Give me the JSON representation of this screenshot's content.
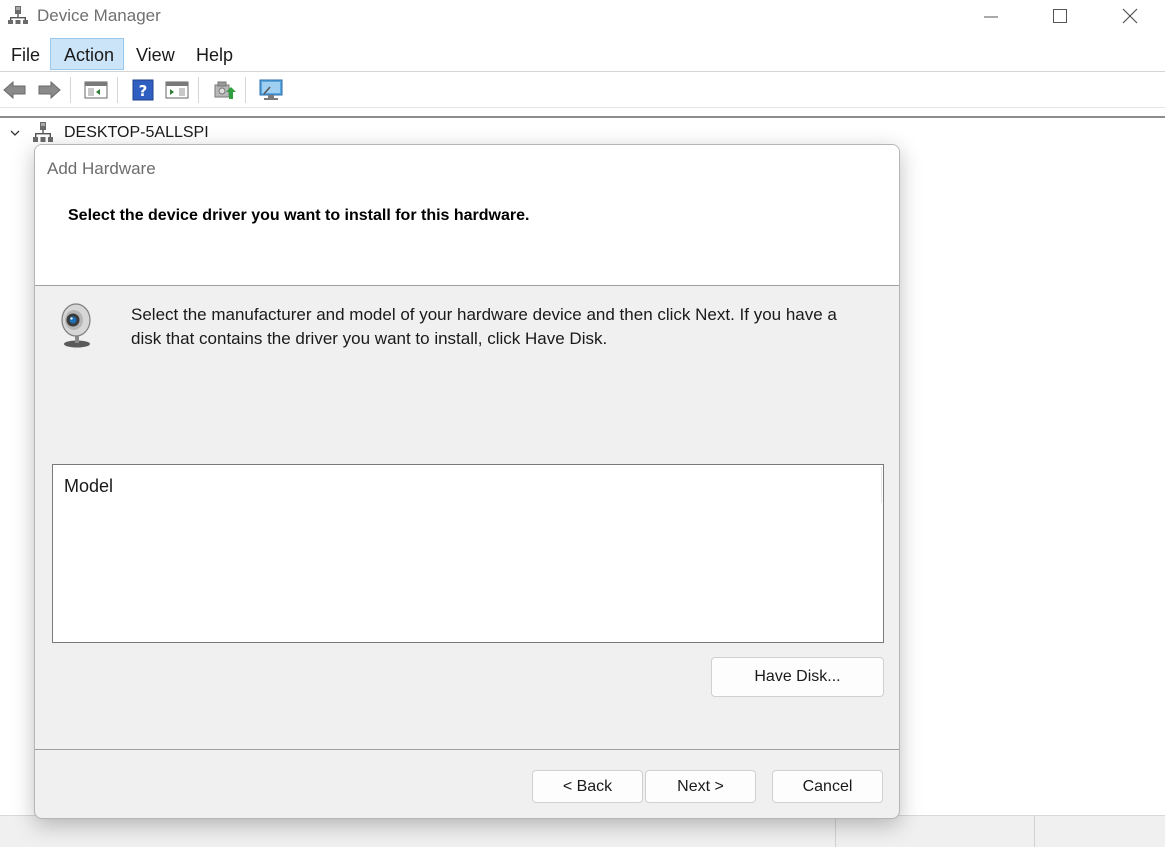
{
  "window": {
    "title": "Device Manager",
    "icon": "device-manager-icon",
    "controls": [
      "minimize-icon",
      "maximize-icon",
      "close-icon"
    ]
  },
  "menu": {
    "items": [
      {
        "label": "File"
      },
      {
        "label": "Action"
      },
      {
        "label": "View"
      },
      {
        "label": "Help"
      }
    ],
    "active": "Action"
  },
  "toolbar": {
    "buttons": [
      "back-arrow-icon",
      "forward-arrow-icon",
      "show-hide-console-tree-icon",
      "help-icon",
      "show-action-pane-icon",
      "update-driver-icon",
      "scan-hardware-changes-icon"
    ]
  },
  "tree": {
    "root_label": "DESKTOP-5ALLSPI"
  },
  "dialog": {
    "title": "Add Hardware",
    "heading": "Select the device driver you want to install for this hardware.",
    "instructions": "Select the manufacturer and model of your hardware device and then click Next. If you have a disk that contains the driver you want to install, click Have Disk.",
    "icon": "webcam-icon",
    "model_header": "Model",
    "have_disk_label": "Have Disk...",
    "back_label": "< Back",
    "next_label": "Next >",
    "cancel_label": "Cancel"
  },
  "colors": {
    "menu_active_bg": "#cce4f7",
    "dialog_bg": "#f0f0f0",
    "header_bg": "#ffffff"
  }
}
